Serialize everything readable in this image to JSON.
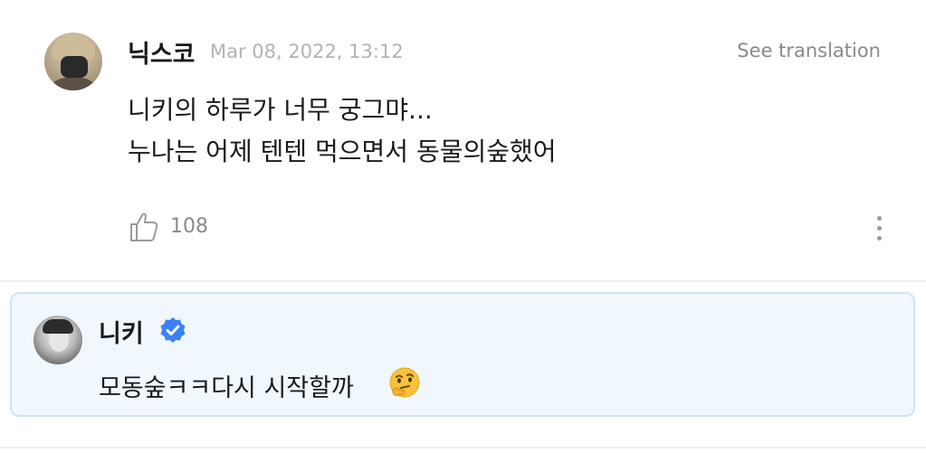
{
  "comment": {
    "username": "닉스코",
    "timestamp": "Mar 08, 2022, 13:12",
    "translate_label": "See translation",
    "body": [
      "니키의 하루가 너무 궁그먀...",
      "누나는 어제 텐텐 먹으면서 동물의숲했어"
    ],
    "like_count": "108",
    "like_icon": "thumbs-up-icon",
    "more_icon": "more-vertical-icon"
  },
  "reply": {
    "username": "니키",
    "verified_icon": "verified-badge-icon",
    "text": "모동숲ㅋㅋ다시 시작할까",
    "emoji": "thinking-face-emoji",
    "colors": {
      "background": "#f0f7fd",
      "border": "#cfe4f5",
      "verified": "#3b82f6"
    }
  }
}
